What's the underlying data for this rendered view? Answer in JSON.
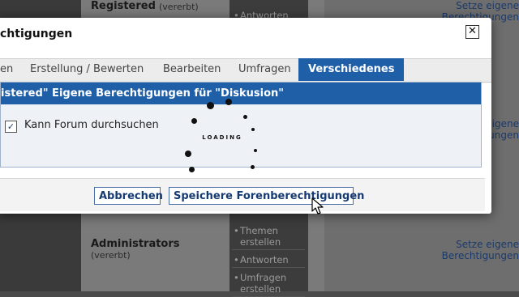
{
  "background": {
    "group_top": {
      "name": "Registered",
      "inherited": "(vererbt)"
    },
    "group_bottom": {
      "name": "Administrators",
      "inherited": "(vererbt)"
    },
    "link_top": "Setze eigene Berechtigungen",
    "link_middle": "Setze eigene Berechtigungen",
    "link_bottom": "Setze eigene Berechtigungen",
    "menu_top": [
      "Antworten"
    ],
    "menu_bottom": [
      "Themen erstellen",
      "Antworten",
      "Umfragen erstellen"
    ]
  },
  "dialog": {
    "title": "chtigungen",
    "close_label": "✕",
    "tabs": [
      {
        "label": "en"
      },
      {
        "label": "Erstellung / Bewerten"
      },
      {
        "label": "Bearbeiten"
      },
      {
        "label": "Umfragen"
      },
      {
        "label": "Verschiedenes",
        "active": true
      }
    ],
    "panel_header": "istered\" Eigene Berechtigungen für \"Diskusion\"",
    "checkbox": {
      "checked": true,
      "label": "Kann Forum durchsuchen"
    },
    "loading_text": "LOADING",
    "buttons": {
      "cancel": "Abbrechen",
      "save": "Speichere Forenberechtigungen"
    }
  },
  "colors": {
    "accent": "#1f5fa8",
    "link": "#163a73"
  }
}
